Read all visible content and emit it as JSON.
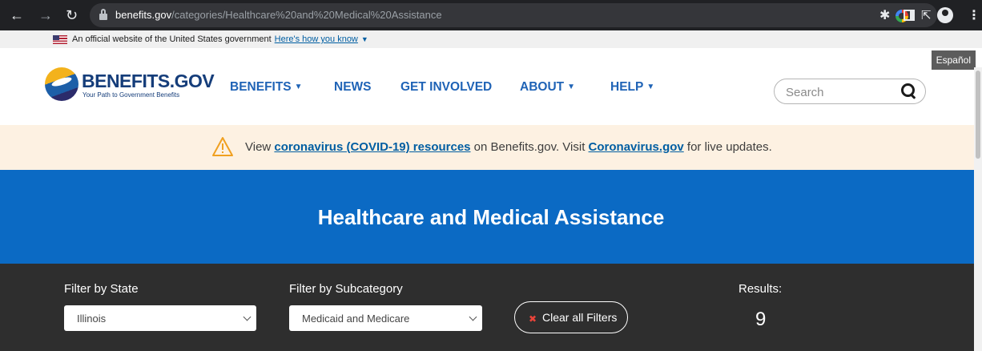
{
  "browser": {
    "url_host": "benefits.gov",
    "url_path": "/categories/Healthcare%20and%20Medical%20Assistance"
  },
  "gov_banner": {
    "text": "An official website of the United States government",
    "link": "Here's how you know"
  },
  "header": {
    "language_button": "Español",
    "logo_title": "BENEFITS.GOV",
    "logo_tagline": "Your Path to Government Benefits",
    "nav": [
      {
        "label": "BENEFITS",
        "dropdown": true
      },
      {
        "label": "NEWS",
        "dropdown": false
      },
      {
        "label": "GET INVOLVED",
        "dropdown": false
      },
      {
        "label": "ABOUT",
        "dropdown": true
      },
      {
        "label": "HELP",
        "dropdown": true
      }
    ],
    "search_placeholder": "Search"
  },
  "alert": {
    "pre": "View ",
    "link1": "coronavirus (COVID-19) resources",
    "mid": " on Benefits.gov. Visit ",
    "link2": "Coronavirus.gov",
    "post": " for live updates."
  },
  "hero": {
    "title": "Healthcare and Medical Assistance"
  },
  "filters": {
    "state_label": "Filter by State",
    "state_value": "Illinois",
    "subcategory_label": "Filter by Subcategory",
    "subcategory_value": "Medicaid and Medicare",
    "clear_label": "Clear all Filters",
    "results_label": "Results:",
    "results_count": "9"
  },
  "colors": {
    "hero_blue": "#0b6ac4",
    "nav_blue": "#1f63b6",
    "alert_bg": "#fdf1e2",
    "filter_bg": "#2e2e2e"
  }
}
